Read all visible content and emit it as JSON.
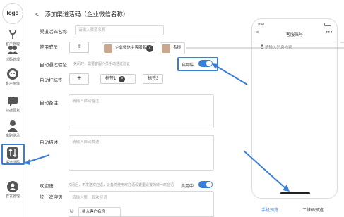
{
  "sidebar": {
    "logo": "logo",
    "items": [
      {
        "label": "客户管理",
        "icon": "person-icon"
      },
      {
        "label": "活码管理",
        "icon": "people-icon"
      },
      {
        "label": "客户画像",
        "icon": "face-icon"
      },
      {
        "label": "快捷回复",
        "icon": "chat-icon"
      },
      {
        "label": "离职继承",
        "icon": "user-icon"
      },
      {
        "label": "渠道活码",
        "icon": "swap-icon"
      },
      {
        "label": "群发管理",
        "icon": "group-icon"
      }
    ]
  },
  "header": {
    "back": "<",
    "title": "添加渠道活码（企业微信名称）"
  },
  "form": {
    "channel_name_label": "渠道活码名称",
    "channel_name_placeholder": "请输入渠道名称",
    "members_label": "使用成员",
    "member_1": "企业微信中客服名称",
    "member_2": "名称",
    "auto_verify_label": "自动通过验证",
    "auto_verify_hint": "关闭时，需要客服人员手动通过验证",
    "auto_verify_toggle_label": "启用中",
    "auto_tag_label": "自动打标签",
    "tag_1": "标签1",
    "tag_2": "标签3",
    "auto_remark_label": "自动备注",
    "auto_remark_placeholder": "请输入自动备注",
    "auto_desc_label": "自动描述",
    "auto_desc_placeholder": "请输入自动描述",
    "welcome_label": "欢迎语",
    "welcome_hint": "关闭后，不发送欢迎语，设备将使用欢迎语设置里设置的统一欢迎语",
    "welcome_toggle_label": "启用中",
    "unified_welcome_label": "统一欢迎语",
    "unified_welcome_placeholder": "请输入第一段欢迎语",
    "insert_name_label": "插入客户名称"
  },
  "phone": {
    "status_time": "9:41",
    "title": "客服账号",
    "close": "×",
    "more": "•••",
    "message": "请输入消息内容",
    "tab_preview": "手机预览",
    "tab_qr": "二维码预览"
  },
  "colors": {
    "accent": "#3a7fd5"
  }
}
